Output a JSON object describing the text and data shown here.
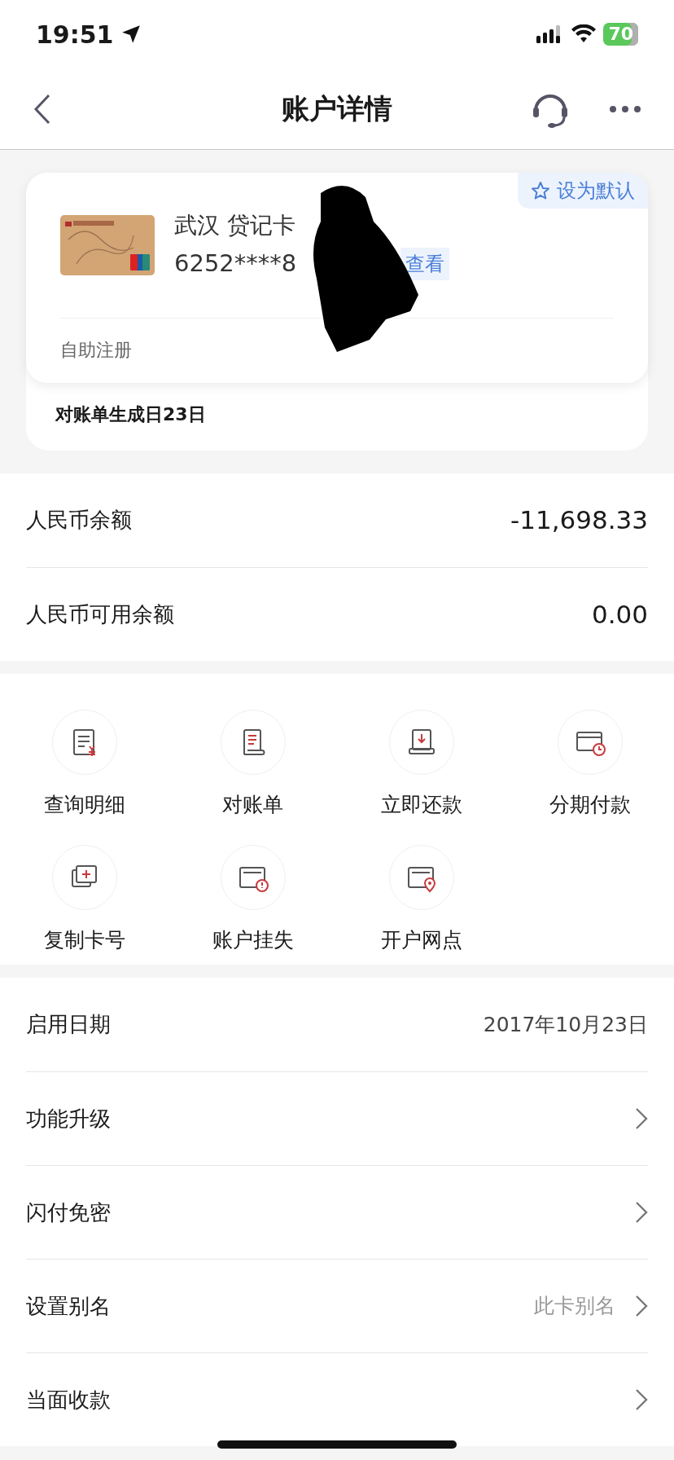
{
  "status_bar": {
    "time": "19:51",
    "battery": "70"
  },
  "header": {
    "title": "账户详情"
  },
  "card": {
    "default_button": "设为默认",
    "name": "武汉 贷记卡",
    "number": "6252****8",
    "view_button": "查看",
    "registration": "自助注册",
    "statement_day": "对账单生成日23日"
  },
  "balances": [
    {
      "label": "人民币余额",
      "value": "-11,698.33"
    },
    {
      "label": "人民币可用余额",
      "value": "0.00"
    }
  ],
  "actions": [
    {
      "label": "查询明细",
      "kind": "detail"
    },
    {
      "label": "对账单",
      "kind": "statement"
    },
    {
      "label": "立即还款",
      "kind": "repay"
    },
    {
      "label": "分期付款",
      "kind": "installment"
    },
    {
      "label": "复制卡号",
      "kind": "copy"
    },
    {
      "label": "账户挂失",
      "kind": "loss"
    },
    {
      "label": "开户网点",
      "kind": "branch"
    }
  ],
  "rows": [
    {
      "label": "启用日期",
      "value": "2017年10月23日",
      "kind": "info"
    },
    {
      "label": "功能升级",
      "kind": "link"
    },
    {
      "label": "闪付免密",
      "kind": "link"
    },
    {
      "label": "设置别名",
      "value": "此卡别名",
      "kind": "link"
    },
    {
      "label": "当面收款",
      "kind": "link"
    }
  ]
}
